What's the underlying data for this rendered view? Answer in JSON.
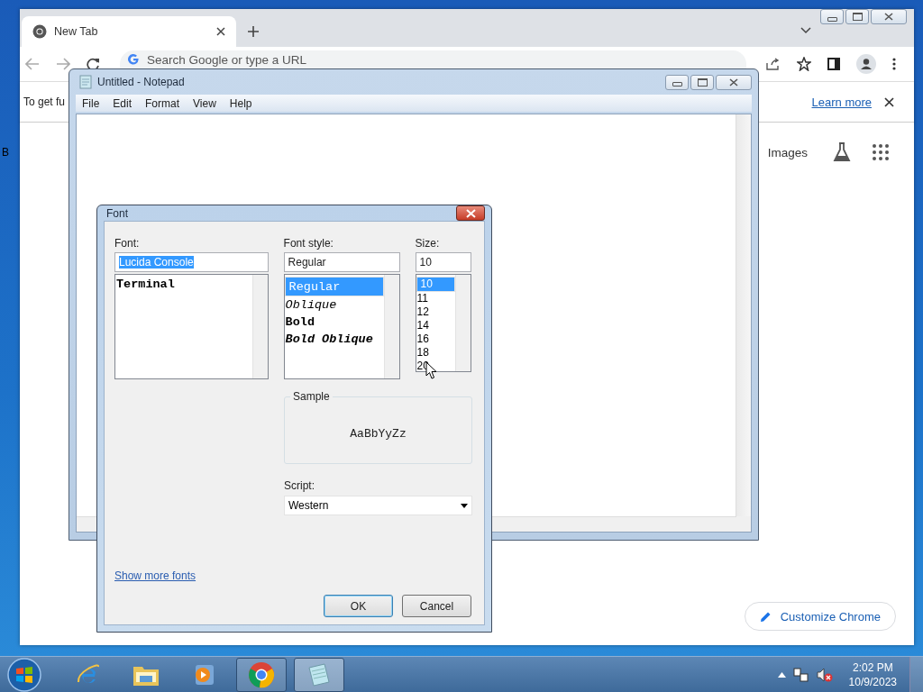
{
  "desktop": {
    "edge_text": "B"
  },
  "browser": {
    "tabs": [
      {
        "title": "New Tab",
        "selected": true
      }
    ],
    "address_placeholder": "Search Google or type a URL",
    "infobar": {
      "text": "To get fu",
      "link": "Learn more"
    },
    "header_links": [
      "Images"
    ],
    "customize_button": "Customize Chrome"
  },
  "notepad": {
    "title": "Untitled - Notepad",
    "menu": [
      "File",
      "Edit",
      "Format",
      "View",
      "Help"
    ]
  },
  "font_dialog": {
    "title": "Font",
    "font": {
      "label": "Font:",
      "value": "Lucida Console",
      "value_highlighted": true,
      "items": [
        {
          "name": "Terminal",
          "kind": "bold",
          "selected": false
        }
      ]
    },
    "style": {
      "label": "Font style:",
      "value": "Regular",
      "value_highlighted": false,
      "items": [
        {
          "name": "Regular",
          "kind": "regular",
          "selected": true
        },
        {
          "name": "Oblique",
          "kind": "oblique",
          "selected": false
        },
        {
          "name": "Bold",
          "kind": "bold",
          "selected": false
        },
        {
          "name": "Bold Oblique",
          "kind": "bold_oblique",
          "selected": false
        }
      ]
    },
    "size": {
      "label": "Size:",
      "value": "10",
      "value_highlighted": false,
      "items": [
        {
          "name": "10",
          "selected": true
        },
        {
          "name": "11",
          "selected": false
        },
        {
          "name": "12",
          "selected": false
        },
        {
          "name": "14",
          "selected": false
        },
        {
          "name": "16",
          "selected": false
        },
        {
          "name": "18",
          "selected": false
        },
        {
          "name": "20",
          "selected": false
        }
      ]
    },
    "sample": {
      "label": "Sample",
      "text": "AaBbYyZz"
    },
    "script": {
      "label": "Script:",
      "value": "Western"
    },
    "more_link": "Show more fonts",
    "buttons": [
      {
        "label": "OK",
        "default": true
      },
      {
        "label": "Cancel",
        "default": false
      }
    ]
  },
  "taskbar": {
    "apps": [
      {
        "kind": "ie",
        "running": false,
        "selected": false
      },
      {
        "kind": "explorer",
        "running": false,
        "selected": false
      },
      {
        "kind": "media",
        "running": false,
        "selected": false
      },
      {
        "kind": "chrome",
        "running": true,
        "selected": false
      },
      {
        "kind": "notepad",
        "running": true,
        "selected": true
      }
    ],
    "time": "2:02 PM",
    "date": "10/9/2023"
  }
}
